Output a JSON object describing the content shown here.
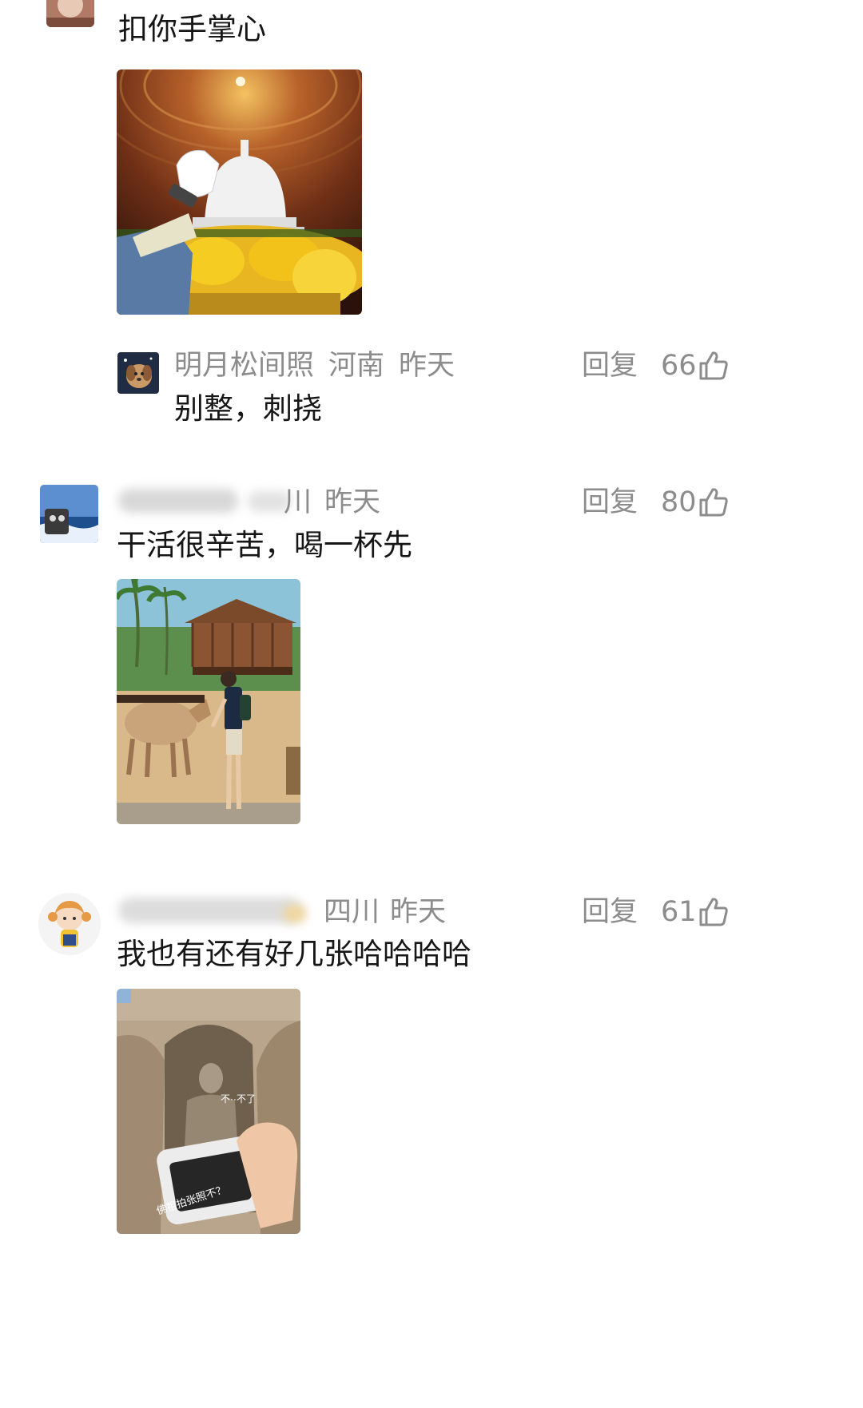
{
  "comments": [
    {
      "text": "扣你手掌心",
      "image": "photo-hand-pinching-white-stupa"
    },
    {
      "username": "明月松间照",
      "region": "河南",
      "time": "昨天",
      "text": "别整，刺挠",
      "reply_label": "回复",
      "likes": "66"
    },
    {
      "username": "",
      "region": "川",
      "time": "昨天",
      "text": "干活很辛苦，喝一杯先",
      "reply_label": "回复",
      "likes": "80",
      "image": "photo-man-feeding-painted-ox"
    },
    {
      "username": "",
      "region": "四川",
      "time": "昨天",
      "text": "我也有还有好几张哈哈哈哈",
      "reply_label": "回复",
      "likes": "61",
      "image": "photo-camera-grotto-buddha",
      "image_caption_top": "不··不了",
      "image_caption_bottom": "佛祖拍张照不？"
    }
  ],
  "icons": {
    "like": "thumbs-up-icon"
  },
  "colors": {
    "text": "#161616",
    "meta": "#8c8c8c",
    "background": "#ffffff"
  }
}
